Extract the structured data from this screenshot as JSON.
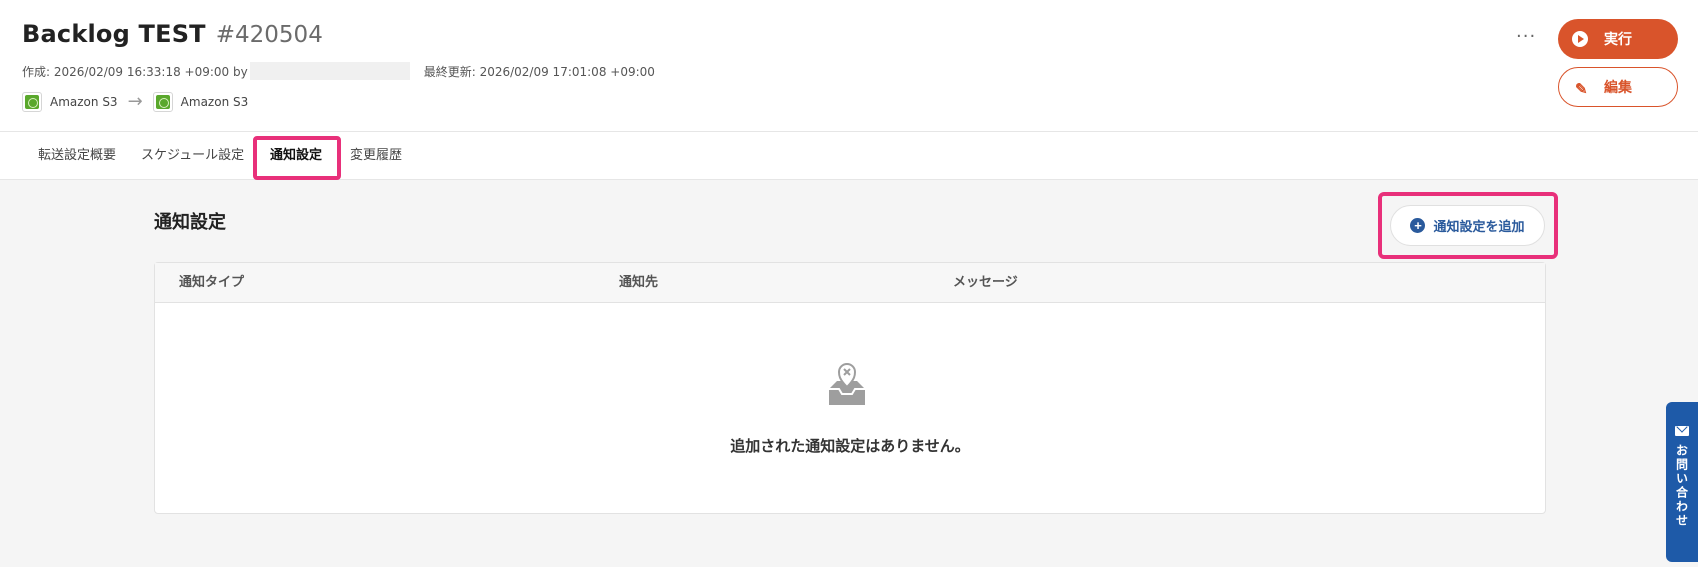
{
  "header": {
    "title": "Backlog TEST",
    "job_id": "#420504",
    "created": "作成: 2026/02/09 16:33:18 +09:00 by",
    "updated": "最終更新: 2026/02/09 17:01:08 +09:00",
    "source": "Amazon S3",
    "destination": "Amazon S3",
    "more": "···",
    "run_label": "実行",
    "edit_label": "編集"
  },
  "tabs": [
    {
      "label": "転送設定概要"
    },
    {
      "label": "スケジュール設定"
    },
    {
      "label": "通知設定"
    },
    {
      "label": "変更履歴"
    }
  ],
  "main": {
    "section_title": "通知設定",
    "add_label": "通知設定を追加",
    "columns": [
      "通知タイプ",
      "通知先",
      "メッセージ"
    ],
    "empty_text": "追加された通知設定はありません。"
  },
  "contact": {
    "label": "お問い合わせ"
  },
  "colors": {
    "accent": "#d9542b",
    "link": "#2a5a9c",
    "highlight": "#e8307a",
    "contact_bg": "#1e5aa8"
  }
}
